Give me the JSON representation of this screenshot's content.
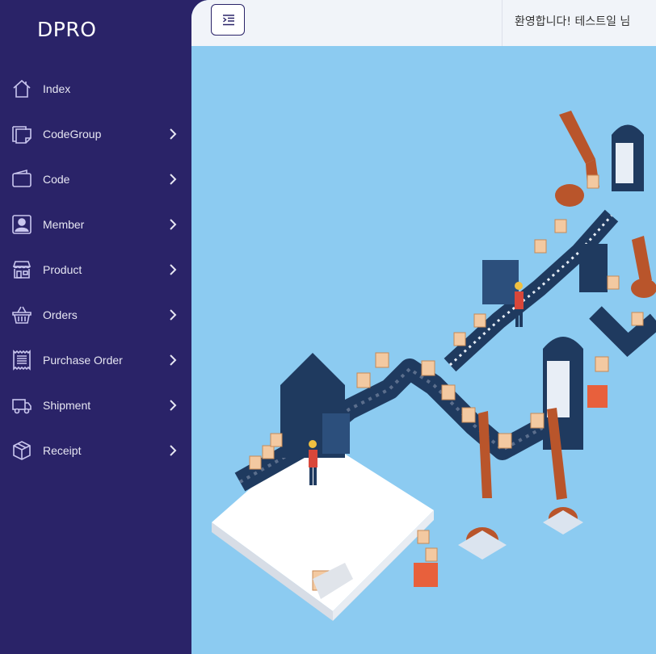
{
  "brand": {
    "title": "DPRO"
  },
  "sidebar": {
    "items": [
      {
        "label": "Index",
        "icon": "home-icon",
        "has_submenu": false
      },
      {
        "label": "CodeGroup",
        "icon": "sticky-note-icon",
        "has_submenu": true
      },
      {
        "label": "Code",
        "icon": "wallet-icon",
        "has_submenu": true
      },
      {
        "label": "Member",
        "icon": "person-badge-icon",
        "has_submenu": true
      },
      {
        "label": "Product",
        "icon": "shop-icon",
        "has_submenu": true
      },
      {
        "label": "Orders",
        "icon": "basket-icon",
        "has_submenu": true
      },
      {
        "label": "Purchase Order",
        "icon": "receipt-icon",
        "has_submenu": true
      },
      {
        "label": "Shipment",
        "icon": "truck-icon",
        "has_submenu": true
      },
      {
        "label": "Receipt",
        "icon": "box-icon",
        "has_submenu": true
      }
    ]
  },
  "header": {
    "welcome_text": "환영합니다!  테스트일  님",
    "toggle_icon": "text-indent-icon"
  },
  "colors": {
    "sidebar_bg": "#2a2368",
    "content_bg": "#8ccbf1",
    "topbar_bg": "#f1f4f9"
  },
  "hero": {
    "illustration": "factory-conveyor-illustration"
  }
}
